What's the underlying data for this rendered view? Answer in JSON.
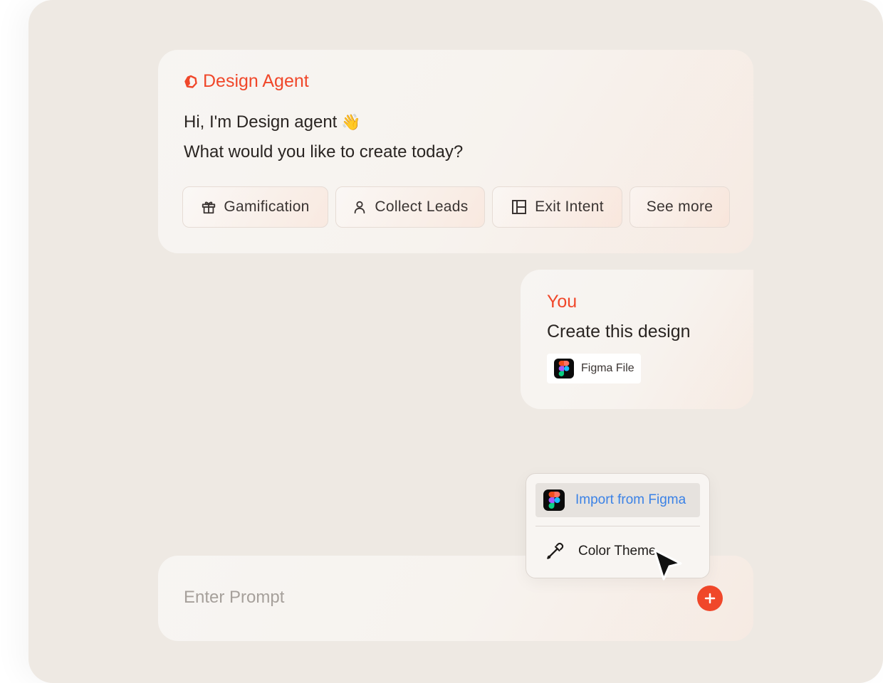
{
  "agent": {
    "title": "Design Agent",
    "greeting": "Hi, I'm Design agent",
    "wave_emoji": "👋",
    "question": "What would you like to create today?",
    "chips": [
      {
        "label": "Gamification",
        "icon": "gift-icon"
      },
      {
        "label": "Collect Leads",
        "icon": "user-icon"
      },
      {
        "label": "Exit Intent",
        "icon": "layout-icon"
      },
      {
        "label": "See more"
      }
    ]
  },
  "user_message": {
    "author": "You",
    "text": "Create this design",
    "attachment": {
      "label": "Figma File",
      "icon": "figma-icon"
    }
  },
  "menu": {
    "items": [
      {
        "label": "Import from Figma",
        "icon": "figma-icon",
        "highlighted": true
      },
      {
        "label": "Color Theme",
        "icon": "eyedropper-icon"
      }
    ]
  },
  "prompt": {
    "placeholder": "Enter Prompt",
    "add_icon": "plus-icon"
  },
  "colors": {
    "accent": "#f0472a",
    "link": "#3b82e6",
    "background": "#eee9e3"
  }
}
